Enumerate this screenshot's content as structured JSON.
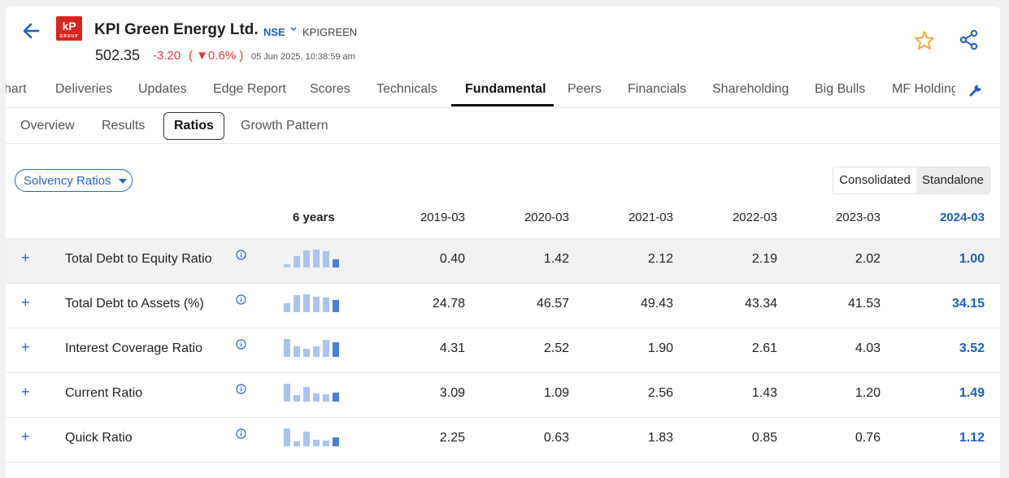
{
  "header": {
    "company": "KPI Green Energy Ltd.",
    "exchange": "NSE",
    "symbol": "KPIGREEN",
    "price": "502.35",
    "change": "-3.20",
    "change_pct": "( ▼0.6% )",
    "timestamp": "05 Jun 2025, 10:38:59 am"
  },
  "tabs": [
    "hart",
    "Deliveries",
    "Updates",
    "Edge Report",
    "Scores",
    "Technicals",
    "Fundamental",
    "Peers",
    "Financials",
    "Shareholding",
    "Big Bulls",
    "MF Holding"
  ],
  "active_tab": "Fundamental",
  "subtabs": [
    "Overview",
    "Results",
    "Ratios",
    "Growth Pattern"
  ],
  "active_subtab": "Ratios",
  "ratio_dropdown": "Solvency Ratios",
  "toggle": {
    "consolidated": "Consolidated",
    "standalone": "Standalone",
    "selected": "Standalone"
  },
  "table": {
    "spark_header": "6 years",
    "years": [
      "2019-03",
      "2020-03",
      "2021-03",
      "2022-03",
      "2023-03",
      "2024-03"
    ],
    "rows": [
      {
        "label": "Total Debt to Equity Ratio",
        "values": [
          "0.40",
          "1.42",
          "2.12",
          "2.19",
          "2.02",
          "1.00"
        ]
      },
      {
        "label": "Total Debt to Assets (%)",
        "values": [
          "24.78",
          "46.57",
          "49.43",
          "43.34",
          "41.53",
          "34.15"
        ]
      },
      {
        "label": "Interest Coverage Ratio",
        "values": [
          "4.31",
          "2.52",
          "1.90",
          "2.61",
          "4.03",
          "3.52"
        ]
      },
      {
        "label": "Current Ratio",
        "values": [
          "3.09",
          "1.09",
          "2.56",
          "1.43",
          "1.20",
          "1.49"
        ]
      },
      {
        "label": "Quick Ratio",
        "values": [
          "2.25",
          "0.63",
          "1.83",
          "0.85",
          "0.76",
          "1.12"
        ]
      }
    ]
  },
  "colors": {
    "accent": "#1f5fbf",
    "negative": "#e03a3a",
    "logo": "#d7261e",
    "star": "#f2a623",
    "spark": "#a9c4ee",
    "spark_last": "#4a7fd9"
  },
  "icons": {
    "back": "arrow-left-icon",
    "star": "star-outline-icon",
    "share": "share-icon",
    "info": "info-icon",
    "wrench": "wrench-icon",
    "expand": "plus-icon"
  }
}
